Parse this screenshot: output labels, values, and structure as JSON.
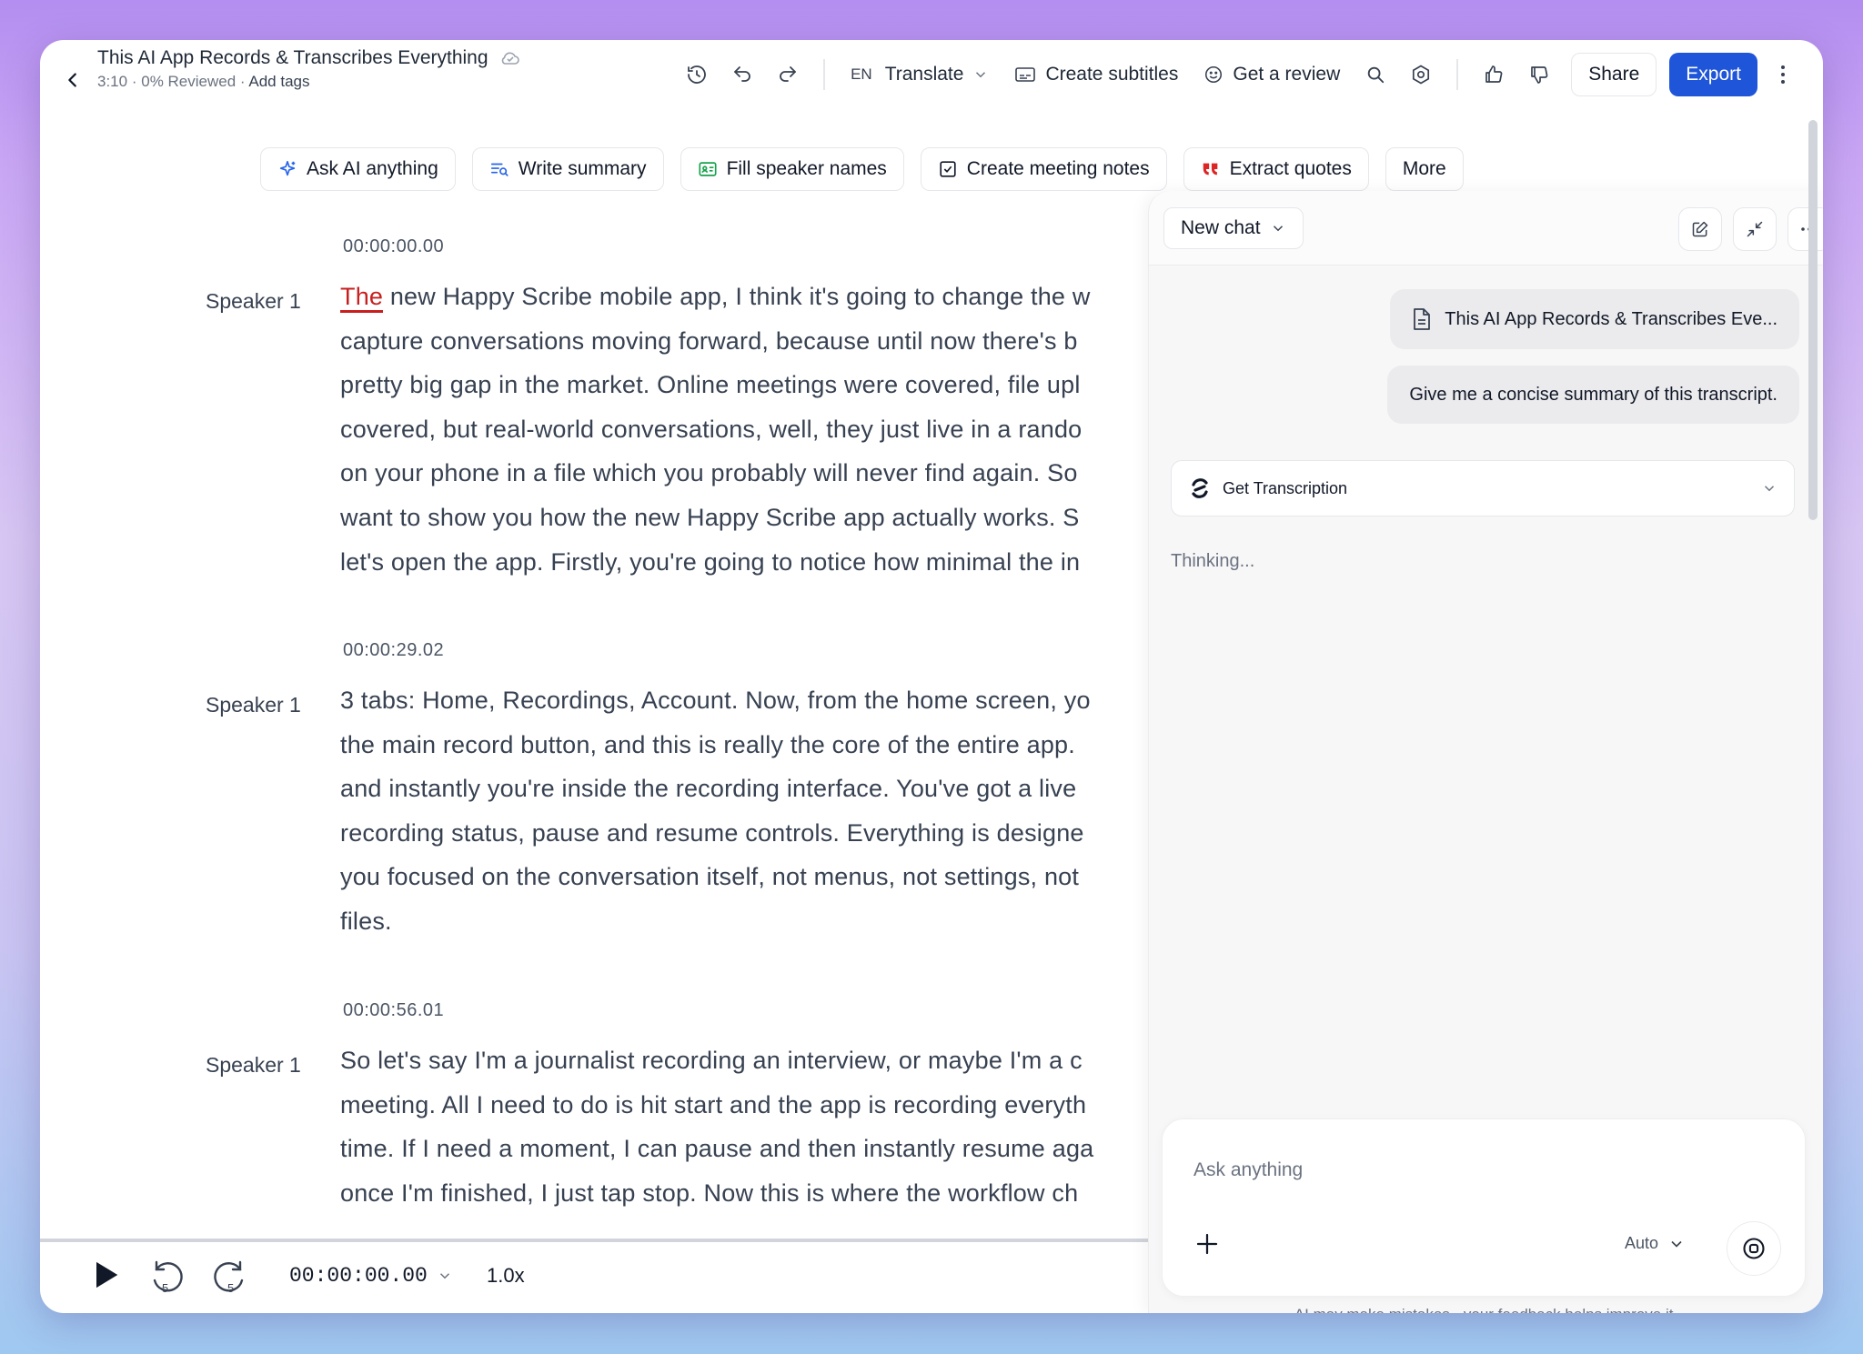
{
  "header": {
    "title": "This AI App Records & Transcribes Everything",
    "meta_duration": "3:10",
    "meta_reviewed": "0% Reviewed",
    "meta_sep": "·",
    "add_tags": "Add tags",
    "lang": "EN",
    "translate": "Translate",
    "create_subtitles": "Create subtitles",
    "get_review": "Get a review",
    "share": "Share",
    "export": "Export"
  },
  "ai_actions": [
    {
      "label": "Ask AI anything",
      "icon": "sparkle-icon"
    },
    {
      "label": "Write summary",
      "icon": "summary-icon"
    },
    {
      "label": "Fill speaker names",
      "icon": "id-card-icon"
    },
    {
      "label": "Create meeting notes",
      "icon": "checkbox-icon"
    },
    {
      "label": "Extract quotes",
      "icon": "quote-icon"
    },
    {
      "label": "More",
      "icon": ""
    }
  ],
  "segments": [
    {
      "timestamp": "00:00:00.00",
      "speaker": "Speaker 1",
      "first_word": "The",
      "text": " new Happy Scribe mobile app, I think it's going to change the w",
      "lines": [
        "capture conversations moving forward, because until now there's b",
        "pretty big gap in the market. Online meetings were covered, file upl",
        "covered, but real-world conversations, well, they just live in a rando",
        "on your phone in a file which you probably will never find again. So",
        "want to show you how the new Happy Scribe app actually works. S",
        "let's open the app. Firstly, you're going to notice how minimal the in"
      ]
    },
    {
      "timestamp": "00:00:29.02",
      "speaker": "Speaker 1",
      "lines": [
        "3 tabs: Home, Recordings, Account. Now, from the home screen, yo",
        "the main record button, and this is really the core of the entire app.",
        "and instantly you're inside the recording interface. You've got a live",
        "recording status, pause and resume controls. Everything is designe",
        "you focused on the conversation itself, not menus, not settings, not",
        "files."
      ]
    },
    {
      "timestamp": "00:00:56.01",
      "speaker": "Speaker 1",
      "lines": [
        "So let's say I'm a journalist recording an interview, or maybe I'm a c",
        "meeting. All I need to do is hit start and the app is recording everyth",
        "time. If I need a moment, I can pause and then instantly resume aga",
        "once I'm finished, I just tap stop. Now this is where the workflow ch"
      ]
    }
  ],
  "player": {
    "time": "00:00:00.00",
    "speed": "1.0x",
    "skip_back_seconds": "5",
    "skip_forward_seconds": "5"
  },
  "chat": {
    "new_chat": "New chat",
    "file_bubble": "This AI App Records & Transcribes Eve...",
    "user_message": "Give me a concise summary of this transcript.",
    "tool_label": "Get Transcription",
    "thinking": "Thinking...",
    "input_placeholder": "Ask anything",
    "mode": "Auto",
    "disclaimer": "AI may make mistakes - your feedback helps improve it."
  },
  "colors": {
    "accent": "#1f55d8",
    "current_word": "#c81e1e"
  }
}
